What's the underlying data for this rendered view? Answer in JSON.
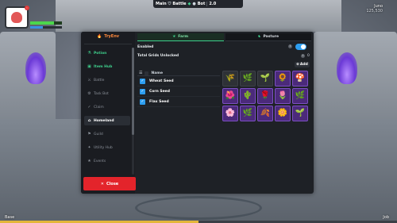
{
  "hud": {
    "topbar": {
      "main": "Main",
      "battle": "Battle",
      "bot": "Bot",
      "version": "2.0"
    },
    "topright": {
      "player": "Juno",
      "coords": "125,530"
    },
    "health_fraction": 0.75,
    "xp_fraction": 0.4,
    "level_progress_fraction": 0.5,
    "bottom_left": "Base",
    "bottom_right": "Job"
  },
  "sidebar": {
    "brand": "TryEnv",
    "items": [
      {
        "label": "Potion",
        "icon": "potion-icon",
        "style": "green"
      },
      {
        "label": "Item Hub",
        "icon": "item-hub-icon",
        "style": "green"
      },
      {
        "label": "Battle",
        "icon": "battle-icon",
        "style": "normal"
      },
      {
        "label": "Task Bot",
        "icon": "task-bot-icon",
        "style": "normal"
      },
      {
        "label": "Claim",
        "icon": "claim-icon",
        "style": "normal"
      },
      {
        "label": "Homeland",
        "icon": "homeland-icon",
        "style": "active"
      },
      {
        "label": "Guild",
        "icon": "guild-icon",
        "style": "normal"
      },
      {
        "label": "Utility Hub",
        "icon": "utility-icon",
        "style": "normal"
      },
      {
        "label": "Events",
        "icon": "events-icon",
        "style": "normal"
      }
    ],
    "close_label": "Close"
  },
  "tabs": [
    {
      "label": "Farm",
      "icon": "leaf-icon",
      "active": true
    },
    {
      "label": "Pasture",
      "icon": "pasture-icon",
      "active": false
    }
  ],
  "farm": {
    "enabled_label": "Enabled",
    "enabled": true,
    "total_grids_label": "Total Grids Unlocked",
    "total_grids_value": "0",
    "add_label": "Add",
    "list_header": "Name",
    "seeds": [
      {
        "name": "Wheat Seed",
        "checked": true
      },
      {
        "name": "Corn Seed",
        "checked": true
      },
      {
        "name": "Flax Seed",
        "checked": true
      }
    ],
    "grid": [
      {
        "style": "dark",
        "glyph": "🌾"
      },
      {
        "style": "dark",
        "glyph": "🌿"
      },
      {
        "style": "dark",
        "glyph": "🌱"
      },
      {
        "style": "purple",
        "glyph": "🌻"
      },
      {
        "style": "purple",
        "glyph": "🍄"
      },
      {
        "style": "purple",
        "glyph": "🌺"
      },
      {
        "style": "purple",
        "glyph": "🌵"
      },
      {
        "style": "purple",
        "glyph": "🌹"
      },
      {
        "style": "purple",
        "glyph": "🌷"
      },
      {
        "style": "purple",
        "glyph": "🌿"
      },
      {
        "style": "purple",
        "glyph": "🌸"
      },
      {
        "style": "purple",
        "glyph": "🌿"
      },
      {
        "style": "purple",
        "glyph": "🍂"
      },
      {
        "style": "purple",
        "glyph": "🌼"
      },
      {
        "style": "purple",
        "glyph": "🌱"
      }
    ]
  }
}
